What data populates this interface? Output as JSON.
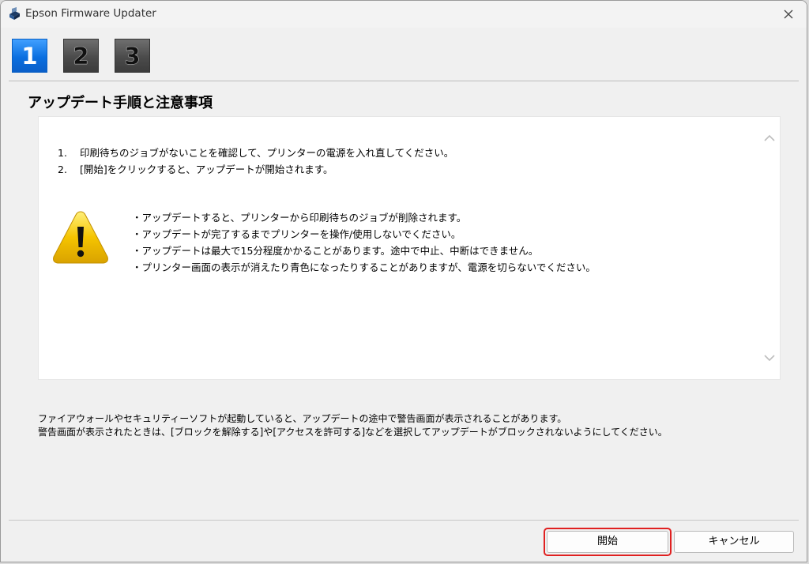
{
  "window": {
    "title": "Epson Firmware Updater"
  },
  "steps": [
    {
      "label": "1",
      "active": true
    },
    {
      "label": "2",
      "active": false
    },
    {
      "label": "3",
      "active": false
    }
  ],
  "main": {
    "heading": "アップデート手順と注意事項",
    "instructions": [
      {
        "num": "1.",
        "text": "印刷待ちのジョブがないことを確認して、プリンターの電源を入れ直してください。"
      },
      {
        "num": "2.",
        "text": "[開始]をクリックすると、アップデートが開始されます。"
      }
    ],
    "warnings": [
      "・アップデートすると、プリンターから印刷待ちのジョブが削除されます。",
      "・アップデートが完了するまでプリンターを操作/使用しないでください。",
      "・アップデートは最大で15分程度かかることがあります。途中で中止、中断はできません。",
      "・プリンター画面の表示が消えたり青色になったりすることがありますが、電源を切らないでください。"
    ]
  },
  "footer": {
    "lines": [
      "ファイアウォールやセキュリティーソフトが起動していると、アップデートの途中で警告画面が表示されることがあります。",
      "警告画面が表示されたときは、[ブロックを解除する]や[アクセスを許可する]などを選択してアップデートがブロックされないようにしてください。"
    ]
  },
  "buttons": {
    "start_label": "開始",
    "cancel_label": "キャンセル"
  },
  "colors": {
    "active_step": "#1a7ff0",
    "inactive_step": "#4b4b4b",
    "focus_outline": "#e02020",
    "warning_yellow": "#f5c400"
  },
  "icons": {
    "app": "printer-icon",
    "close": "close-icon",
    "warning": "warning-triangle-icon",
    "scroll_up": "chevron-up-icon",
    "scroll_down": "chevron-down-icon"
  }
}
